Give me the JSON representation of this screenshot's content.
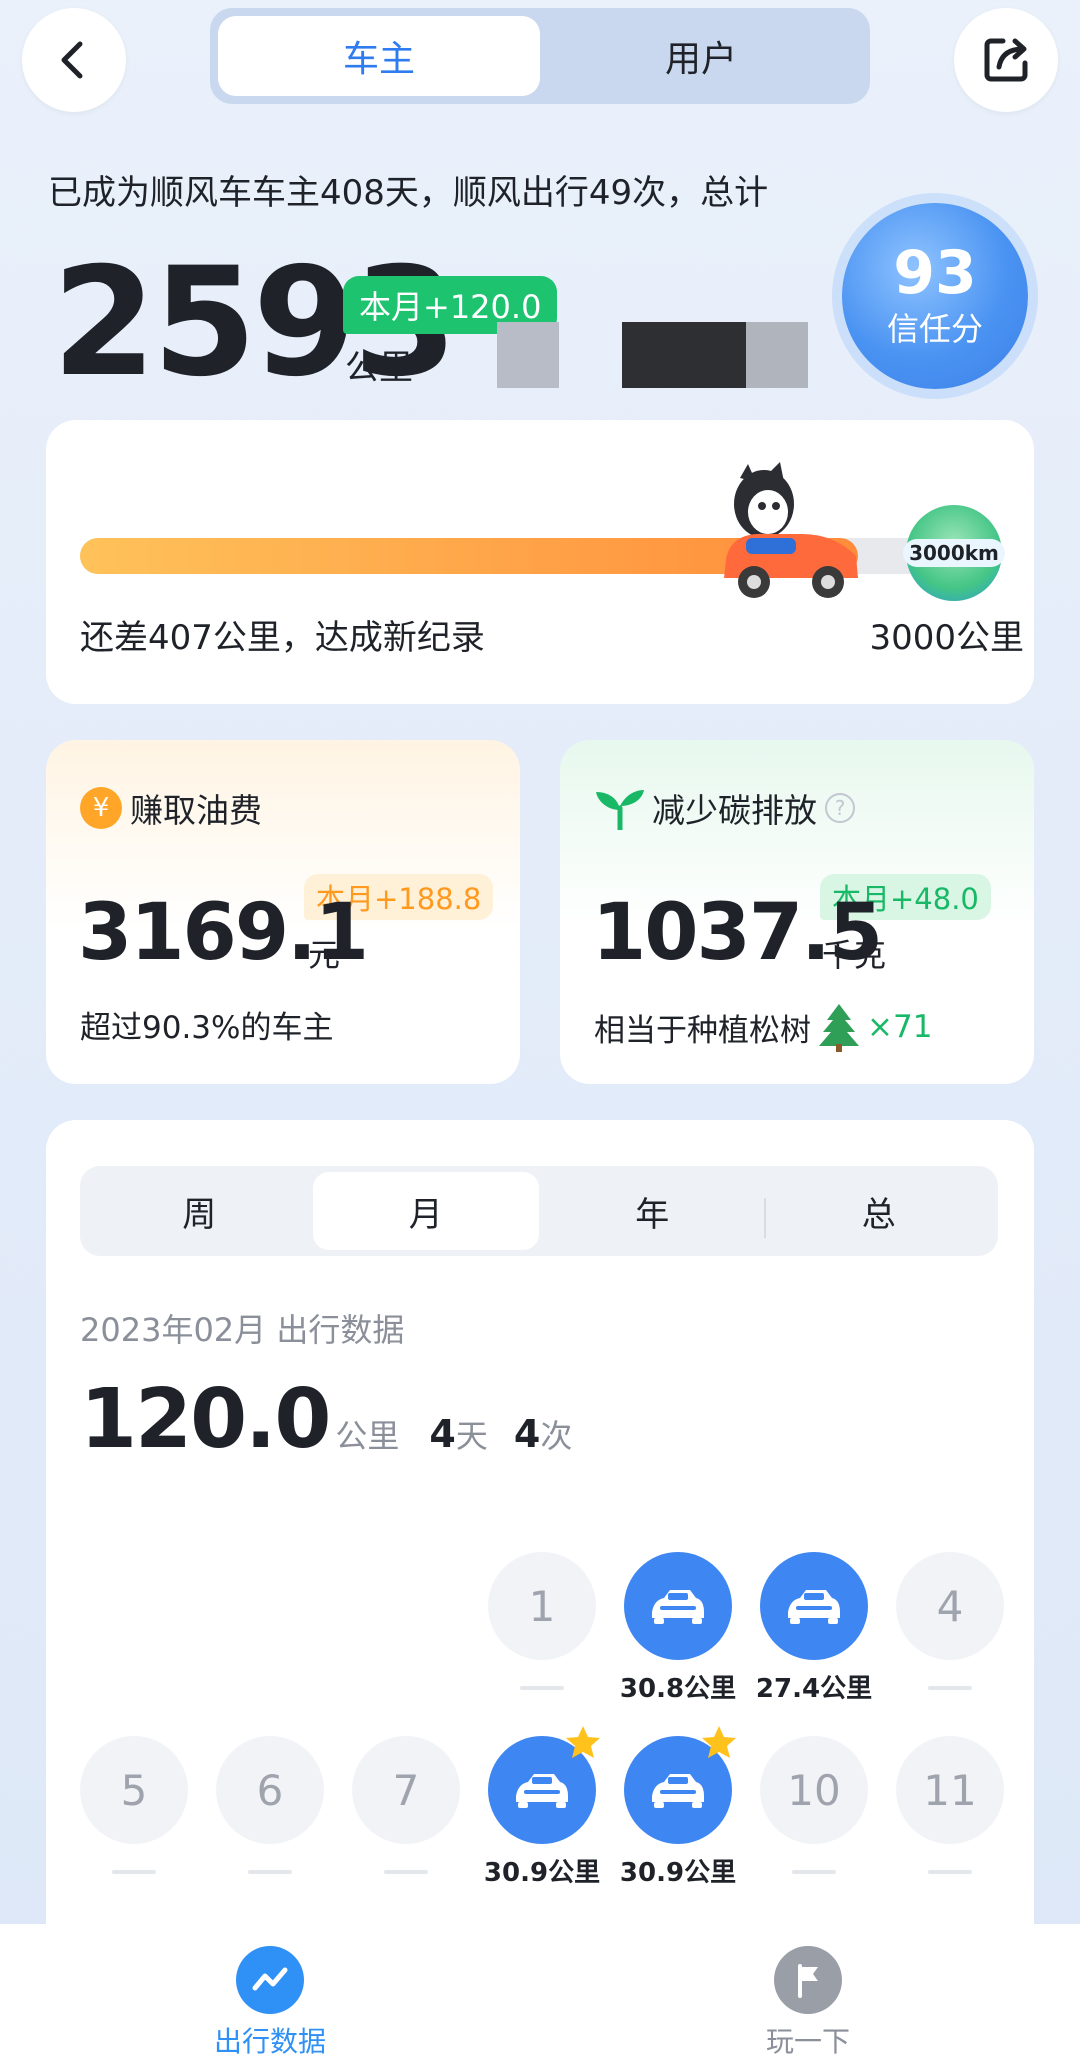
{
  "header": {
    "back_icon": "chevron-left-icon",
    "share_icon": "share-icon",
    "tabs": [
      {
        "label": "车主",
        "active": true
      },
      {
        "label": "用户",
        "active": false
      }
    ]
  },
  "summary": {
    "intro": "已成为顺风车车主408天，顺风出行49次，总计",
    "total_km": "2593",
    "month_tag": "本月+120.0",
    "unit": "公里",
    "trust_score": "93",
    "trust_label": "信任分"
  },
  "progress": {
    "fraction": 0.8643,
    "remaining_text": "还差407公里，达成新纪录",
    "goal_text": "3000公里",
    "goal_badge": "3000km"
  },
  "fuel": {
    "title": "赚取油费",
    "icon": "yen-icon",
    "value": "3169.1",
    "unit": "元",
    "month_tag": "本月+188.8",
    "sub": "超过90.3%的车主"
  },
  "carbon": {
    "title": "减少碳排放",
    "icon": "sprout-icon",
    "value": "1037.5",
    "unit": "千克",
    "month_tag": "本月+48.0",
    "sub_prefix": "相当于种植松树",
    "sub_suffix": "×71"
  },
  "stats": {
    "periods": [
      {
        "label": "周",
        "active": false
      },
      {
        "label": "月",
        "active": true
      },
      {
        "label": "年",
        "active": false
      },
      {
        "label": "总",
        "active": false
      }
    ],
    "date_label": "2023年02月 出行数据",
    "km": "120.0",
    "km_unit": "公里",
    "days": "4",
    "days_unit": "天",
    "trips": "4",
    "trips_unit": "次",
    "calendar": [
      {
        "day": "1",
        "driven": false
      },
      {
        "day": "2",
        "driven": true,
        "km": "30.8公里",
        "star": false
      },
      {
        "day": "3",
        "driven": true,
        "km": "27.4公里",
        "star": false
      },
      {
        "day": "4",
        "driven": false
      },
      {
        "day": "5",
        "driven": false
      },
      {
        "day": "6",
        "driven": false
      },
      {
        "day": "7",
        "driven": false
      },
      {
        "day": "8",
        "driven": true,
        "km": "30.9公里",
        "star": true
      },
      {
        "day": "9",
        "driven": true,
        "km": "30.9公里",
        "star": true
      },
      {
        "day": "10",
        "driven": false
      },
      {
        "day": "11",
        "driven": false
      }
    ]
  },
  "tabbar": [
    {
      "label": "出行数据",
      "icon": "trend-icon",
      "active": true
    },
    {
      "label": "玩一下",
      "icon": "flag-icon",
      "active": false
    }
  ],
  "colors": {
    "accent": "#3e86f2",
    "green": "#1ec36f",
    "orange": "#ff9a1f"
  }
}
